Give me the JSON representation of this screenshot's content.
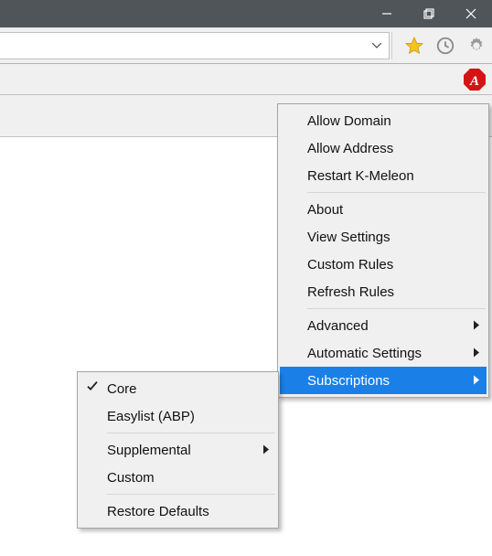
{
  "window": {
    "minimize_tooltip": "Minimize",
    "maximize_tooltip": "Maximize",
    "close_tooltip": "Close"
  },
  "toolbar": {
    "url_value": "",
    "favorites_tooltip": "Favorites",
    "history_tooltip": "History",
    "settings_tooltip": "Settings"
  },
  "adblock": {
    "badge_letter": "A",
    "tooltip": "AdBlock"
  },
  "menu": {
    "group1": [
      "Allow Domain",
      "Allow Address",
      "Restart K-Meleon"
    ],
    "group2": [
      "About",
      "View Settings",
      "Custom Rules",
      "Refresh Rules"
    ],
    "group3": [
      {
        "label": "Advanced",
        "submenu": true
      },
      {
        "label": "Automatic Settings",
        "submenu": true
      },
      {
        "label": "Subscriptions",
        "submenu": true,
        "highlighted": true
      }
    ]
  },
  "submenu": {
    "group1": [
      {
        "label": "Core",
        "checked": true
      },
      {
        "label": "Easylist (ABP)",
        "checked": false
      }
    ],
    "group2": [
      {
        "label": "Supplemental",
        "submenu": true
      },
      {
        "label": "Custom",
        "submenu": false
      }
    ],
    "group3": [
      "Restore Defaults"
    ]
  }
}
